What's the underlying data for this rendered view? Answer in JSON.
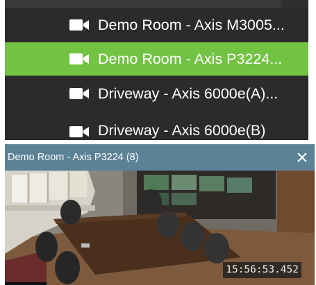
{
  "cameras": [
    {
      "label": "Demo Room - Axis M3005...",
      "icon": "video-camera-icon",
      "selected": false
    },
    {
      "label": "Demo Room - Axis P3224...",
      "icon": "video-camera-icon",
      "selected": true
    },
    {
      "label": "Driveway - Axis 6000e(A)...",
      "icon": "video-camera-icon",
      "selected": false
    },
    {
      "label": "Driveway - Axis 6000e(B)",
      "icon": "video-camera-icon",
      "selected": false
    }
  ],
  "viewer": {
    "title": "Demo Room - Axis P3224 (8)",
    "close_icon": "close-icon",
    "timestamp": "15:56:53.452"
  },
  "colors": {
    "list_background": "#2b2b2b",
    "selected_background": "#72c243",
    "header_background": "#5b8296"
  }
}
